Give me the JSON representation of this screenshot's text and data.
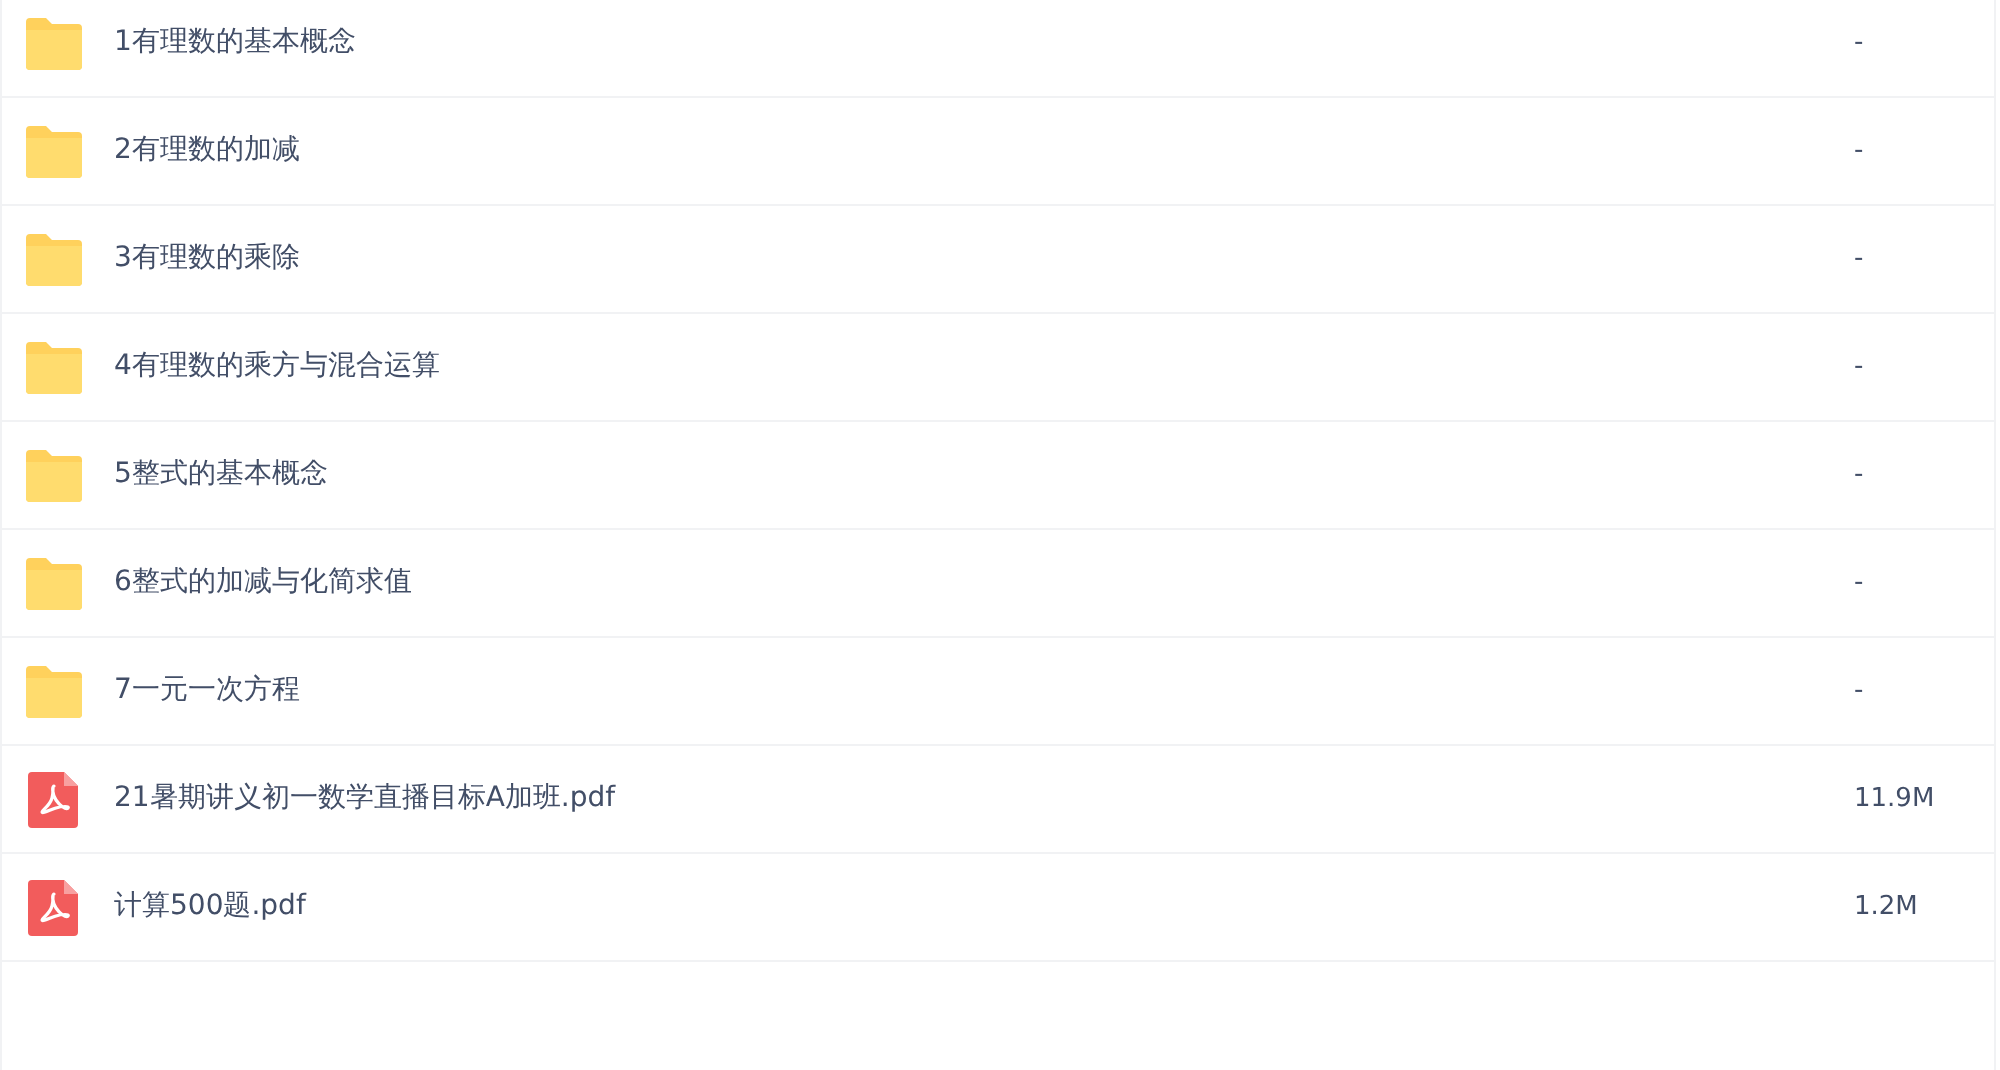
{
  "files": [
    {
      "kind": "folder",
      "name": "1有理数的基本概念",
      "size": "-"
    },
    {
      "kind": "folder",
      "name": "2有理数的加减",
      "size": "-"
    },
    {
      "kind": "folder",
      "name": "3有理数的乘除",
      "size": "-"
    },
    {
      "kind": "folder",
      "name": "4有理数的乘方与混合运算",
      "size": "-"
    },
    {
      "kind": "folder",
      "name": "5整式的基本概念",
      "size": "-"
    },
    {
      "kind": "folder",
      "name": "6整式的加减与化简求值",
      "size": "-"
    },
    {
      "kind": "folder",
      "name": "7一元一次方程",
      "size": "-"
    },
    {
      "kind": "pdf",
      "name": "21暑期讲义初一数学直播目标A加班.pdf",
      "size": "11.9M"
    },
    {
      "kind": "pdf",
      "name": "计算500题.pdf",
      "size": "1.2M"
    }
  ]
}
